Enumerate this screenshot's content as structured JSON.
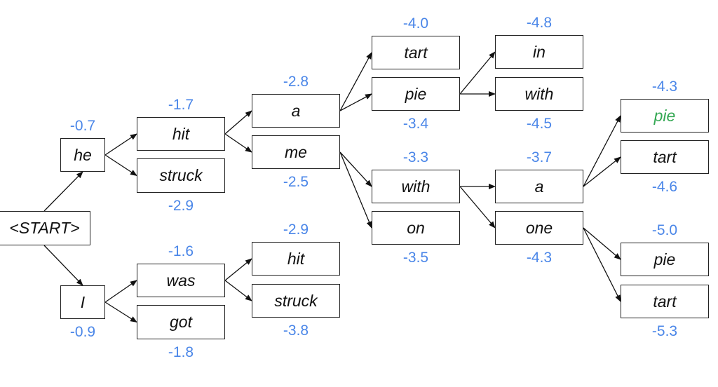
{
  "colors": {
    "score": "#4a86e8",
    "highlight": "#34a853",
    "box_border": "#222222",
    "text": "#111111"
  },
  "nodes": [
    {
      "id": "start",
      "word": "<START>"
    },
    {
      "id": "he",
      "word": "he",
      "score": "-0.7"
    },
    {
      "id": "I",
      "word": "I",
      "score": "-0.9"
    },
    {
      "id": "hit",
      "word": "hit",
      "score": "-1.7"
    },
    {
      "id": "struck",
      "word": "struck",
      "score": "-2.9"
    },
    {
      "id": "was",
      "word": "was",
      "score": "-1.6"
    },
    {
      "id": "got",
      "word": "got",
      "score": "-1.8"
    },
    {
      "id": "a",
      "word": "a",
      "score": "-2.8"
    },
    {
      "id": "me",
      "word": "me",
      "score": "-2.5"
    },
    {
      "id": "hit2",
      "word": "hit",
      "score": "-2.9"
    },
    {
      "id": "struck2",
      "word": "struck",
      "score": "-3.8"
    },
    {
      "id": "tart",
      "word": "tart",
      "score": "-4.0"
    },
    {
      "id": "pie",
      "word": "pie",
      "score": "-3.4"
    },
    {
      "id": "with",
      "word": "with",
      "score": "-3.3"
    },
    {
      "id": "on",
      "word": "on",
      "score": "-3.5"
    },
    {
      "id": "in",
      "word": "in",
      "score": "-4.8"
    },
    {
      "id": "with2",
      "word": "with",
      "score": "-4.5"
    },
    {
      "id": "a2",
      "word": "a",
      "score": "-3.7"
    },
    {
      "id": "one",
      "word": "one",
      "score": "-4.3"
    },
    {
      "id": "pie_best",
      "word": "pie",
      "score": "-4.3",
      "highlight": true
    },
    {
      "id": "tart2",
      "word": "tart",
      "score": "-4.6"
    },
    {
      "id": "pie3",
      "word": "pie",
      "score": "-5.0"
    },
    {
      "id": "tart3",
      "word": "tart",
      "score": "-5.3"
    }
  ],
  "edges": [
    [
      "start",
      "he"
    ],
    [
      "start",
      "I"
    ],
    [
      "he",
      "hit"
    ],
    [
      "he",
      "struck"
    ],
    [
      "I",
      "was"
    ],
    [
      "I",
      "got"
    ],
    [
      "hit",
      "a"
    ],
    [
      "hit",
      "me"
    ],
    [
      "was",
      "hit2"
    ],
    [
      "was",
      "struck2"
    ],
    [
      "a",
      "tart"
    ],
    [
      "a",
      "pie"
    ],
    [
      "me",
      "with"
    ],
    [
      "me",
      "on"
    ],
    [
      "pie",
      "in"
    ],
    [
      "pie",
      "with2"
    ],
    [
      "with",
      "a2"
    ],
    [
      "with",
      "one"
    ],
    [
      "a2",
      "pie_best"
    ],
    [
      "a2",
      "tart2"
    ],
    [
      "one",
      "pie3"
    ],
    [
      "one",
      "tart3"
    ]
  ]
}
